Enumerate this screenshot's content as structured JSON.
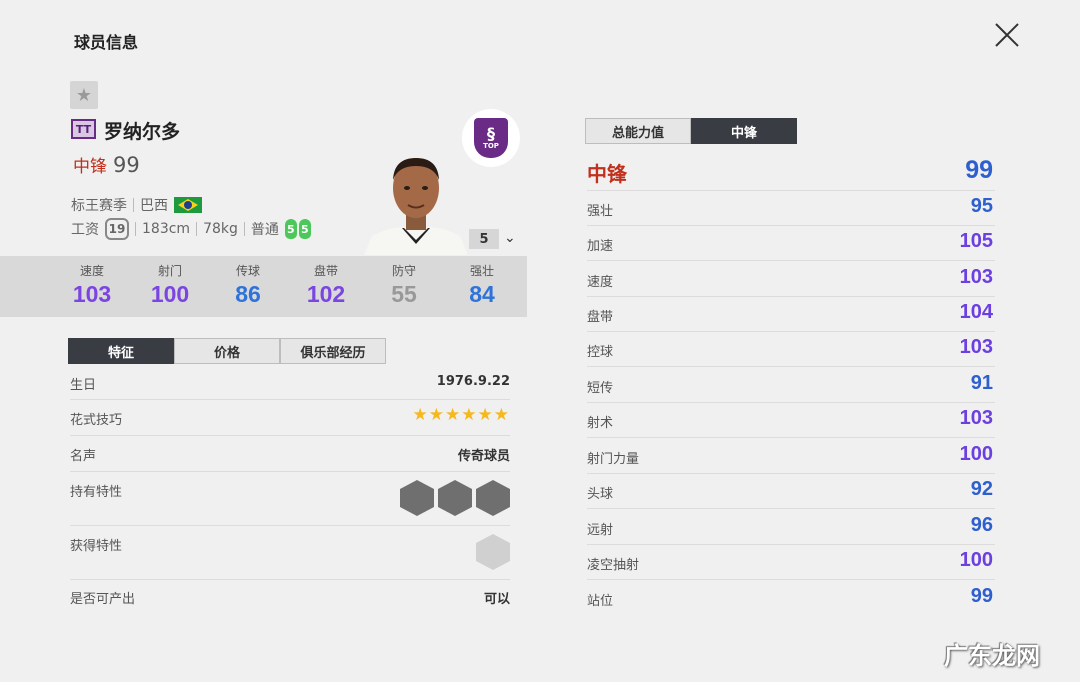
{
  "header": {
    "title": "球员信息"
  },
  "player": {
    "season_tag": "TT",
    "name": "罗纳尔多",
    "position": "中锋",
    "overall": "99",
    "season": "标王赛季",
    "nation": "巴西",
    "salary_label": "工资",
    "salary": "19",
    "height": "183cm",
    "weight": "78kg",
    "body_type": "普通",
    "weak_foot_left": "5",
    "weak_foot_right": "5",
    "level": "5",
    "club_badge_text": "TOP"
  },
  "summary_stats": [
    {
      "label": "速度",
      "value": "103",
      "color": "#7a45e0"
    },
    {
      "label": "射门",
      "value": "100",
      "color": "#7a45e0"
    },
    {
      "label": "传球",
      "value": "86",
      "color": "#2f72d8"
    },
    {
      "label": "盘带",
      "value": "102",
      "color": "#7a45e0"
    },
    {
      "label": "防守",
      "value": "55",
      "color": "#999999"
    },
    {
      "label": "强壮",
      "value": "84",
      "color": "#2f72d8"
    }
  ],
  "left_tabs": [
    "特征",
    "价格",
    "俱乐部经历"
  ],
  "info": {
    "birthday_label": "生日",
    "birthday": "1976.9.22",
    "skill_label": "花式技巧",
    "skill_stars": "★★★★★★",
    "rep_label": "名声",
    "rep": "传奇球员",
    "traits_label": "持有特性",
    "acquired_label": "获得特性",
    "tradable_label": "是否可产出",
    "tradable": "可以"
  },
  "right_tabs": [
    "总能力值",
    "中锋"
  ],
  "attributes": {
    "head_label": "中锋",
    "head_value": "99",
    "rows": [
      {
        "label": "强壮",
        "value": "95"
      },
      {
        "label": "加速",
        "value": "105"
      },
      {
        "label": "速度",
        "value": "103"
      },
      {
        "label": "盘带",
        "value": "104"
      },
      {
        "label": "控球",
        "value": "103"
      },
      {
        "label": "短传",
        "value": "91"
      },
      {
        "label": "射术",
        "value": "103"
      },
      {
        "label": "射门力量",
        "value": "100"
      },
      {
        "label": "头球",
        "value": "92"
      },
      {
        "label": "远射",
        "value": "96"
      },
      {
        "label": "凌空抽射",
        "value": "100"
      },
      {
        "label": "站位",
        "value": "99"
      }
    ]
  },
  "watermark": "广东龙网"
}
